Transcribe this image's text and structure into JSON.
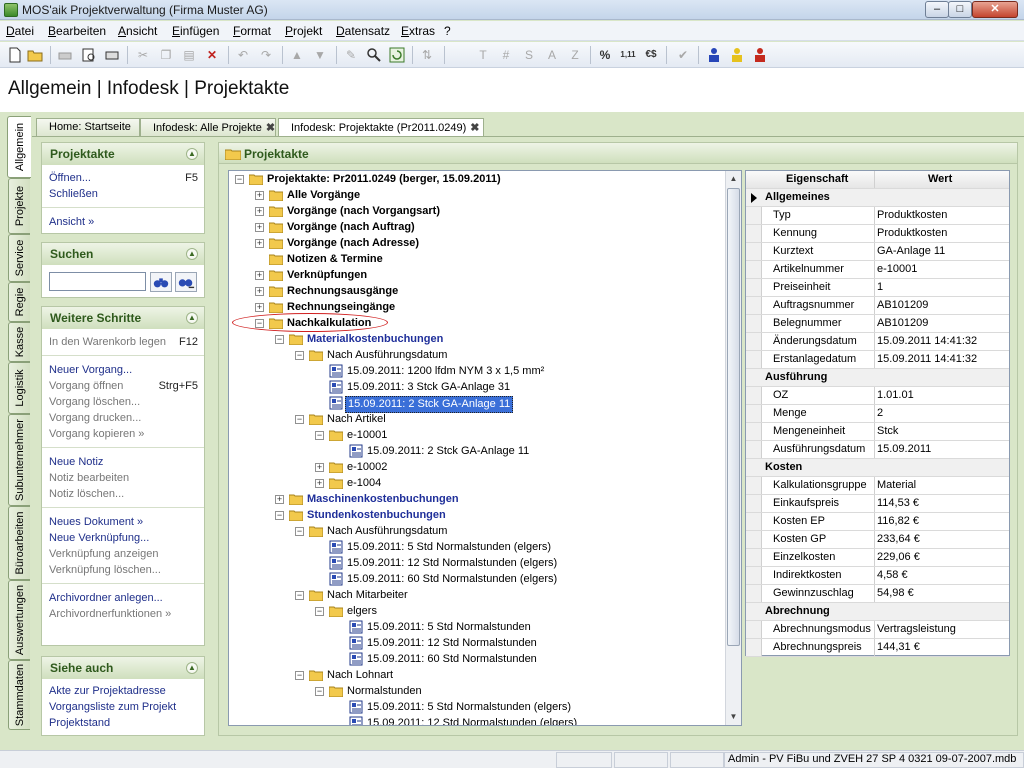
{
  "window": {
    "title": "MOS'aik Projektverwaltung (Firma Muster AG)",
    "minimize": "–",
    "maximize": "□",
    "close": "✕"
  },
  "menu": [
    "Datei",
    "Bearbeiten",
    "Ansicht",
    "Einfügen",
    "Format",
    "Projekt",
    "Datensatz",
    "Extras",
    "?"
  ],
  "header": {
    "title": "Allgemein | Infodesk | Projektakte"
  },
  "side_tabs": [
    "Allgemein",
    "Projekte",
    "Service",
    "Regie",
    "Kasse",
    "Logistik",
    "Subunternehmer",
    "Büroarbeiten",
    "Auswertungen",
    "Stammdaten"
  ],
  "doc_tabs": [
    {
      "label": "Home: Startseite",
      "close": ""
    },
    {
      "label": "Infodesk: Alle Projekte",
      "close": "✖"
    },
    {
      "label": "Infodesk: Projektakte (Pr2011.0249)",
      "close": "✖"
    }
  ],
  "left_panels": {
    "projektakte": {
      "title": "Projektakte",
      "open": "Öffnen...",
      "open_key": "F5",
      "close": "Schließen",
      "view": "Ansicht »"
    },
    "suchen": {
      "title": "Suchen",
      "value": ""
    },
    "weitere": {
      "title": "Weitere Schritte",
      "cart": "In den Warenkorb legen",
      "cart_key": "F12",
      "new_proc": "Neuer Vorgang...",
      "open_proc": "Vorgang öffnen",
      "open_proc_key": "Strg+F5",
      "del_proc": "Vorgang löschen...",
      "print_proc": "Vorgang drucken...",
      "copy_proc": "Vorgang kopieren »",
      "new_note": "Neue Notiz",
      "edit_note": "Notiz bearbeiten",
      "del_note": "Notiz löschen...",
      "new_doc": "Neues Dokument »",
      "new_link": "Neue Verknüpfung...",
      "show_link": "Verknüpfung anzeigen",
      "del_link": "Verknüpfung löschen...",
      "archive_add": "Archivordner anlegen...",
      "archive_fn": "Archivordnerfunktionen »"
    },
    "siehe": {
      "title": "Siehe auch",
      "l1": "Akte zur Projektadresse",
      "l2": "Vorgangsliste zum Projekt",
      "l3": "Projektstand"
    }
  },
  "main": {
    "title": "Projektakte"
  },
  "tree": [
    {
      "text": "Projektakte: Pr2011.0249 (berger, 15.09.2011)",
      "style": "bold",
      "icon": "folder",
      "exp": "−"
    },
    {
      "text": "Alle Vorgänge",
      "style": "bold",
      "icon": "folder",
      "exp": "+"
    },
    {
      "text": "Vorgänge (nach Vorgangsart)",
      "style": "bold",
      "icon": "folder",
      "exp": "+"
    },
    {
      "text": "Vorgänge (nach Auftrag)",
      "style": "bold",
      "icon": "folder",
      "exp": "+"
    },
    {
      "text": "Vorgänge (nach Adresse)",
      "style": "bold",
      "icon": "folder",
      "exp": "+"
    },
    {
      "text": "Notizen & Termine",
      "style": "bold",
      "icon": "folder",
      "exp": ""
    },
    {
      "text": "Verknüpfungen",
      "style": "bold",
      "icon": "folder",
      "exp": "+"
    },
    {
      "text": "Rechnungsausgänge",
      "style": "bold",
      "icon": "folder",
      "exp": "+"
    },
    {
      "text": "Rechnungseingänge",
      "style": "bold",
      "icon": "folder",
      "exp": "+"
    },
    {
      "text": "Nachkalkulation",
      "style": "bold",
      "icon": "folder",
      "exp": "−"
    },
    {
      "text": "Materialkostenbuchungen",
      "style": "blue",
      "icon": "folder",
      "exp": "−"
    },
    {
      "text": "Nach Ausführungsdatum",
      "style": "",
      "icon": "folder",
      "exp": "−"
    },
    {
      "text": "15.09.2011: 1200 lfdm NYM 3 x 1,5 mm²",
      "style": "",
      "icon": "doc",
      "exp": ""
    },
    {
      "text": "15.09.2011: 3 Stck GA-Anlage 31",
      "style": "",
      "icon": "doc",
      "exp": ""
    },
    {
      "text": "15.09.2011: 2 Stck GA-Anlage 11",
      "style": "selected",
      "icon": "doc",
      "exp": ""
    },
    {
      "text": "Nach Artikel",
      "style": "",
      "icon": "folder",
      "exp": "−"
    },
    {
      "text": "e-10001",
      "style": "",
      "icon": "folder",
      "exp": "−"
    },
    {
      "text": "15.09.2011: 2 Stck GA-Anlage 11",
      "style": "",
      "icon": "doc",
      "exp": ""
    },
    {
      "text": "e-10002",
      "style": "",
      "icon": "folder",
      "exp": "+"
    },
    {
      "text": "e-1004",
      "style": "",
      "icon": "folder",
      "exp": "+"
    },
    {
      "text": "Maschinenkostenbuchungen",
      "style": "blue",
      "icon": "folder",
      "exp": "+"
    },
    {
      "text": "Stundenkostenbuchungen",
      "style": "blue",
      "icon": "folder",
      "exp": "−"
    },
    {
      "text": "Nach Ausführungsdatum",
      "style": "",
      "icon": "folder",
      "exp": "−"
    },
    {
      "text": "15.09.2011: 5 Std Normalstunden (elgers)",
      "style": "",
      "icon": "doc",
      "exp": ""
    },
    {
      "text": "15.09.2011: 12 Std Normalstunden (elgers)",
      "style": "",
      "icon": "doc",
      "exp": ""
    },
    {
      "text": "15.09.2011: 60 Std Normalstunden (elgers)",
      "style": "",
      "icon": "doc",
      "exp": ""
    },
    {
      "text": "Nach Mitarbeiter",
      "style": "",
      "icon": "folder",
      "exp": "−"
    },
    {
      "text": "elgers",
      "style": "",
      "icon": "folder",
      "exp": "−"
    },
    {
      "text": "15.09.2011: 5 Std Normalstunden",
      "style": "",
      "icon": "doc",
      "exp": ""
    },
    {
      "text": "15.09.2011: 12 Std Normalstunden",
      "style": "",
      "icon": "doc",
      "exp": ""
    },
    {
      "text": "15.09.2011: 60 Std Normalstunden",
      "style": "",
      "icon": "doc",
      "exp": ""
    },
    {
      "text": "Nach Lohnart",
      "style": "",
      "icon": "folder",
      "exp": "−"
    },
    {
      "text": "Normalstunden",
      "style": "",
      "icon": "folder",
      "exp": "−"
    },
    {
      "text": "15.09.2011: 5 Std Normalstunden (elgers)",
      "style": "",
      "icon": "doc",
      "exp": ""
    },
    {
      "text": "15.09.2011: 12 Std Normalstunden (elgers)",
      "style": "",
      "icon": "doc",
      "exp": ""
    }
  ],
  "properties": {
    "col_key": "Eigenschaft",
    "col_value": "Wert",
    "rows": [
      {
        "cat": "Allgemeines"
      },
      {
        "k": "Typ",
        "v": "Produktkosten"
      },
      {
        "k": "Kennung",
        "v": "Produktkosten"
      },
      {
        "k": "Kurztext",
        "v": "GA-Anlage 11"
      },
      {
        "k": "Artikelnummer",
        "v": "e-10001"
      },
      {
        "k": "Preiseinheit",
        "v": "1"
      },
      {
        "k": "Auftragsnummer",
        "v": "AB101209"
      },
      {
        "k": "Belegnummer",
        "v": "AB101209"
      },
      {
        "k": "Änderungsdatum",
        "v": "15.09.2011 14:41:32"
      },
      {
        "k": "Erstanlagedatum",
        "v": "15.09.2011 14:41:32"
      },
      {
        "cat": "Ausführung"
      },
      {
        "k": "OZ",
        "v": "1.01.01"
      },
      {
        "k": "Menge",
        "v": "2"
      },
      {
        "k": "Mengeneinheit",
        "v": "Stck"
      },
      {
        "k": "Ausführungsdatum",
        "v": "15.09.2011"
      },
      {
        "cat": "Kosten"
      },
      {
        "k": "Kalkulationsgruppe",
        "v": "Material"
      },
      {
        "k": "Einkaufspreis",
        "v": "114,53 €"
      },
      {
        "k": "Kosten EP",
        "v": "116,82 €"
      },
      {
        "k": "Kosten GP",
        "v": "233,64 €"
      },
      {
        "k": "Einzelkosten",
        "v": "229,06 €"
      },
      {
        "k": "Indirektkosten",
        "v": "4,58 €"
      },
      {
        "k": "Gewinnzuschlag",
        "v": "54,98 €"
      },
      {
        "cat": "Abrechnung"
      },
      {
        "k": "Abrechnungsmodus",
        "v": "Vertragsleistung"
      },
      {
        "k": "Abrechnungspreis",
        "v": "144,31 €"
      }
    ]
  },
  "toolbar": {
    "icons": [
      "new-document-icon",
      "open-folder-icon",
      "print-icon",
      "print-preview-icon",
      "print-setup-icon",
      "cut-icon",
      "copy-icon",
      "paste-icon",
      "delete-icon",
      "undo-icon",
      "redo-icon",
      "move-up-icon",
      "move-down-icon",
      "edit-icon",
      "find-icon",
      "refresh-icon",
      "sort-icon",
      "text-icon",
      "hash-icon",
      "s-icon",
      "a-icon",
      "z-icon",
      "percent-icon",
      "decimal-icon",
      "currency-icon",
      "check-icon",
      "user-blue-icon",
      "user-yellow-icon",
      "user-red-icon"
    ],
    "glyphs": {
      "t": "T",
      "hash": "#",
      "s": "S",
      "a": "A",
      "z": "Z",
      "percent": "%",
      "decimal": "1,11",
      "currency": "€$"
    }
  },
  "status": {
    "text": "Admin - PV FiBu und ZVEH 27 SP 4 0321 09-07-2007.mdb"
  },
  "colors": {
    "accent_green": "#2f5a1d",
    "link_blue": "#1f2f8a",
    "selection": "#3a6fd8"
  }
}
